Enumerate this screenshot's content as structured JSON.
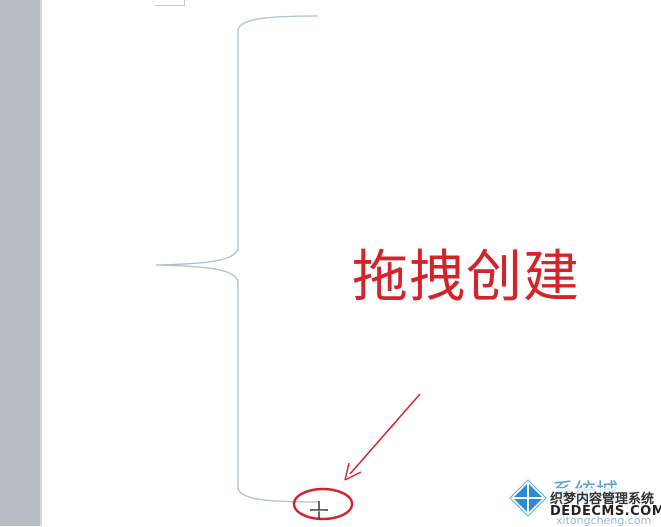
{
  "annotation": {
    "text": "拖拽创建"
  },
  "watermark": {
    "title": "系统城",
    "subtitle": "织梦内容管理系统",
    "domain": "DEDECMS.COM",
    "url": "xitongcheng.com"
  },
  "colors": {
    "brace": "#aebfcd",
    "annotation": "#d4242b",
    "circle": "#d4242b",
    "gutter": "#b7bbc3"
  },
  "icons": {
    "cursor": "crosshair-cursor-icon",
    "logo": "windows-logo-icon"
  }
}
